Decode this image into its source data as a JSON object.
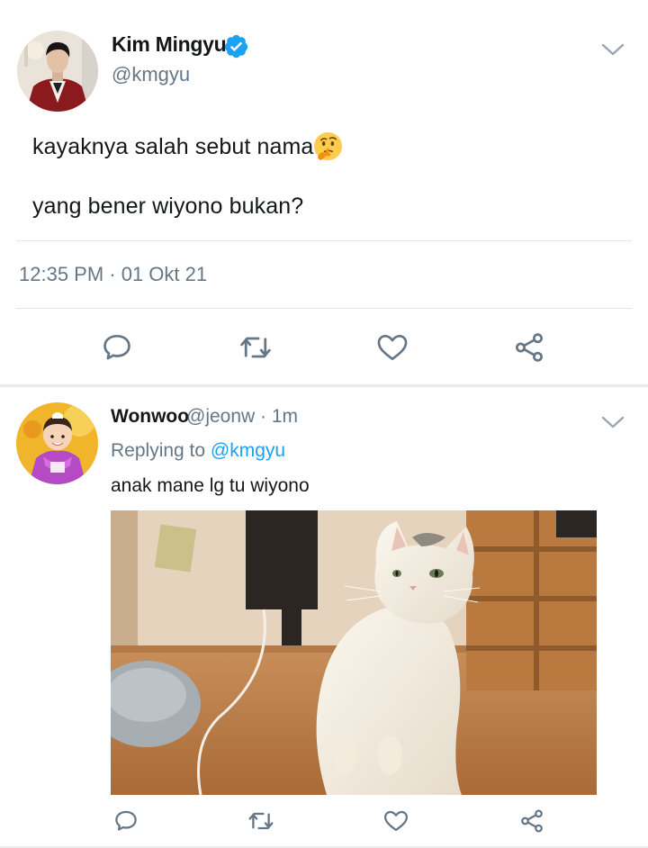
{
  "main_tweet": {
    "display_name": "Kim Mingyu",
    "handle": "@kmgyu",
    "verified": true,
    "text_line1": "kayaknya salah sebut nama",
    "text_line1_emoji": "thinking-face-emoji",
    "text_line2": "yang bener wiyono bukan?",
    "timestamp": "12:35 PM · 01 Okt 21",
    "actions": [
      "reply-icon",
      "retweet-icon",
      "like-icon",
      "share-icon"
    ]
  },
  "reply_tweet": {
    "display_name": "Wonwoo",
    "handle_time": "@jeonw · 1m",
    "replying_prefix": "Replying to",
    "replying_to": "@kmgyu",
    "text": "anak mane lg tu wiyono",
    "actions": [
      "reply-icon",
      "retweet-icon",
      "like-icon",
      "share-icon"
    ]
  },
  "colors": {
    "primary_text": "#14171a",
    "secondary_text": "#657786",
    "link_blue": "#1da1f2",
    "verified_blue": "#1da1f2",
    "divider": "#e1e8ed"
  }
}
